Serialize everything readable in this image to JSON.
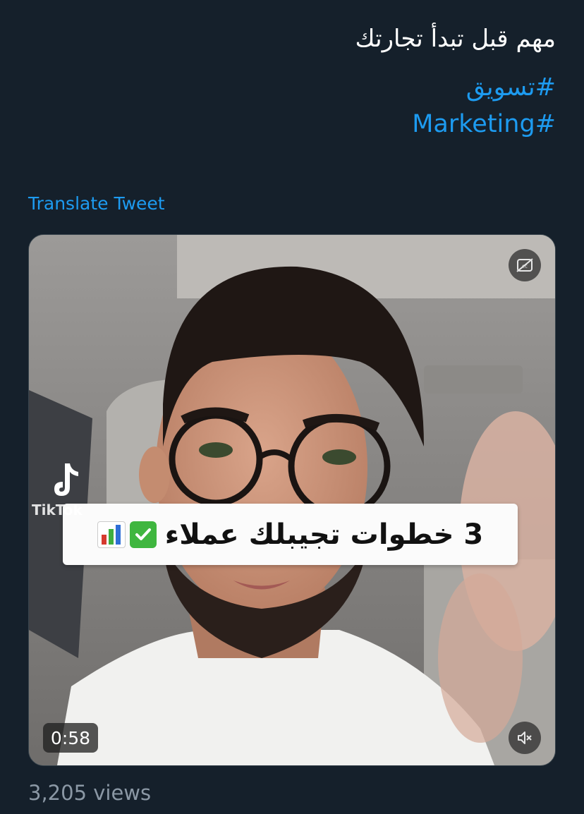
{
  "tweet": {
    "text": "مهم قبل تبدأ تجارتك",
    "hashtags": [
      "#تسويق",
      "#Marketing"
    ],
    "translate_label": "Translate Tweet",
    "link_color": "#1d9bf0"
  },
  "media": {
    "caption": "3 خطوات تجيبلك عملاء",
    "caption_icons": [
      "check-mark-icon",
      "bar-chart-icon"
    ],
    "watermark": "TikTok",
    "duration": "0:58",
    "captions_button_icon": "closed-captions-off-icon",
    "sound_button_icon": "speaker-muted-icon"
  },
  "stats": {
    "views": "3,205 views"
  }
}
